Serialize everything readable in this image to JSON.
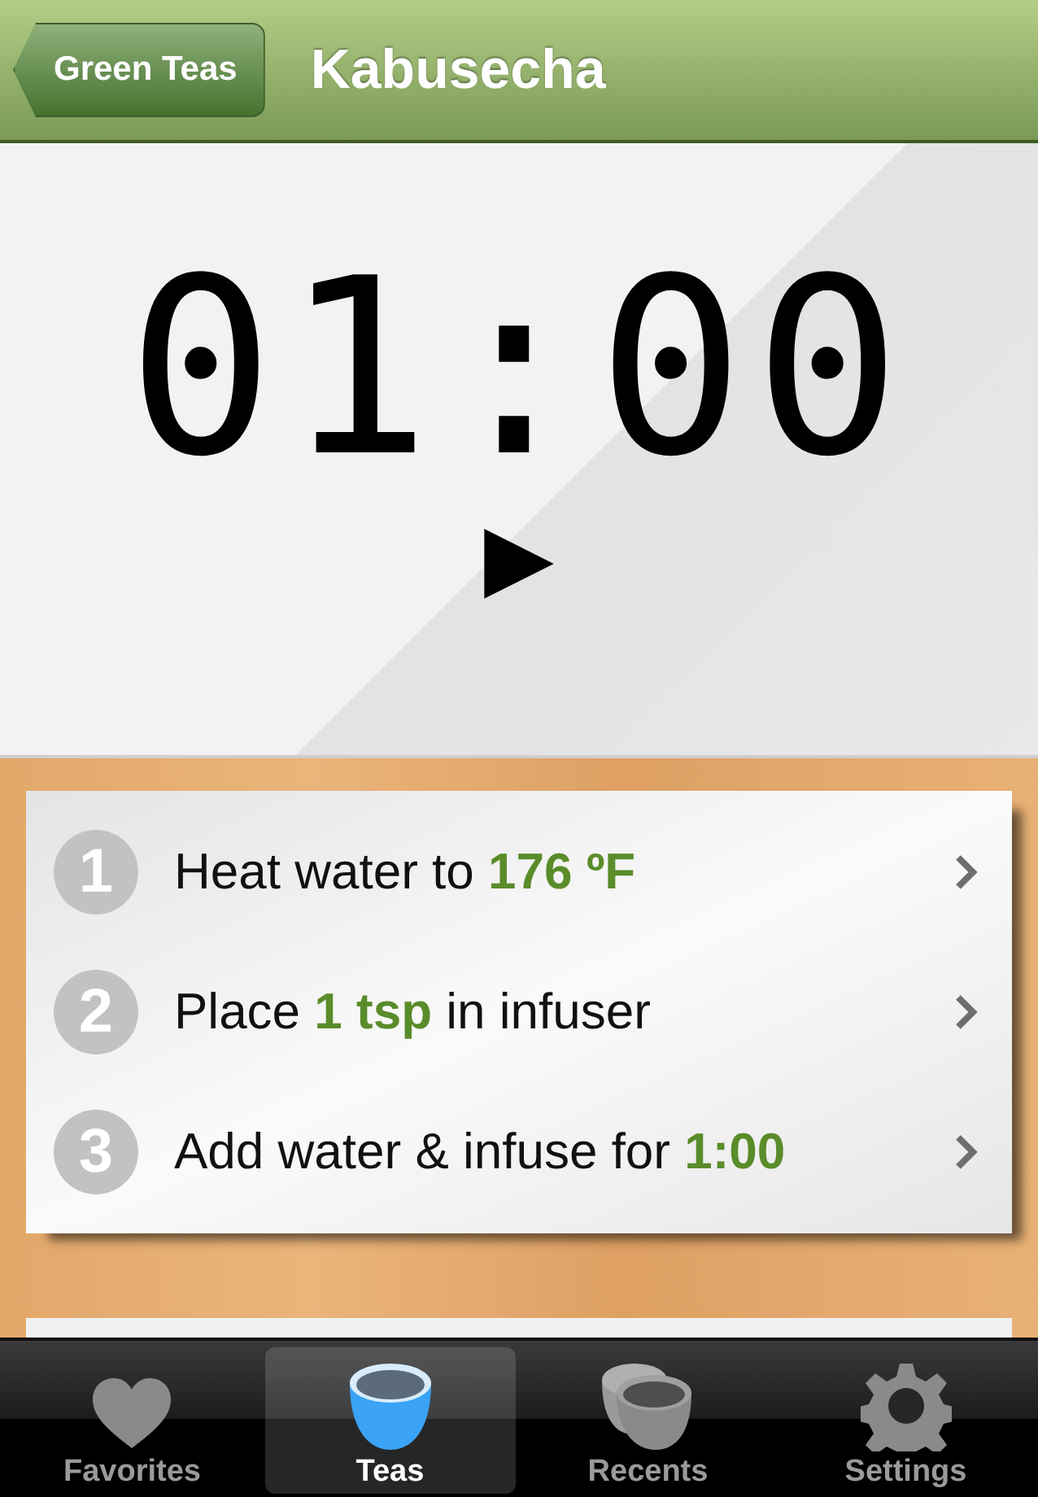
{
  "nav_bar": {
    "back_button": "Green Teas",
    "title": "Kabusecha"
  },
  "timer": {
    "time": "01:00",
    "play_button": "▶"
  },
  "steps": [
    {
      "number": "1",
      "text": "Heat water to **176 ºF**"
    },
    {
      "number": "2",
      "text": "Place **1 tsp** in infuser"
    },
    {
      "number": "3",
      "text": "Add water & infuse for **1:00**"
    }
  ],
  "tab_bar": [
    {
      "label": "Favorites",
      "kind": "heart",
      "selected": false
    },
    {
      "label": "Teas",
      "kind": "cup",
      "selected": true
    },
    {
      "label": "Recents",
      "kind": "cups",
      "selected": false
    },
    {
      "label": "Settings",
      "kind": "gear",
      "selected": false
    }
  ]
}
